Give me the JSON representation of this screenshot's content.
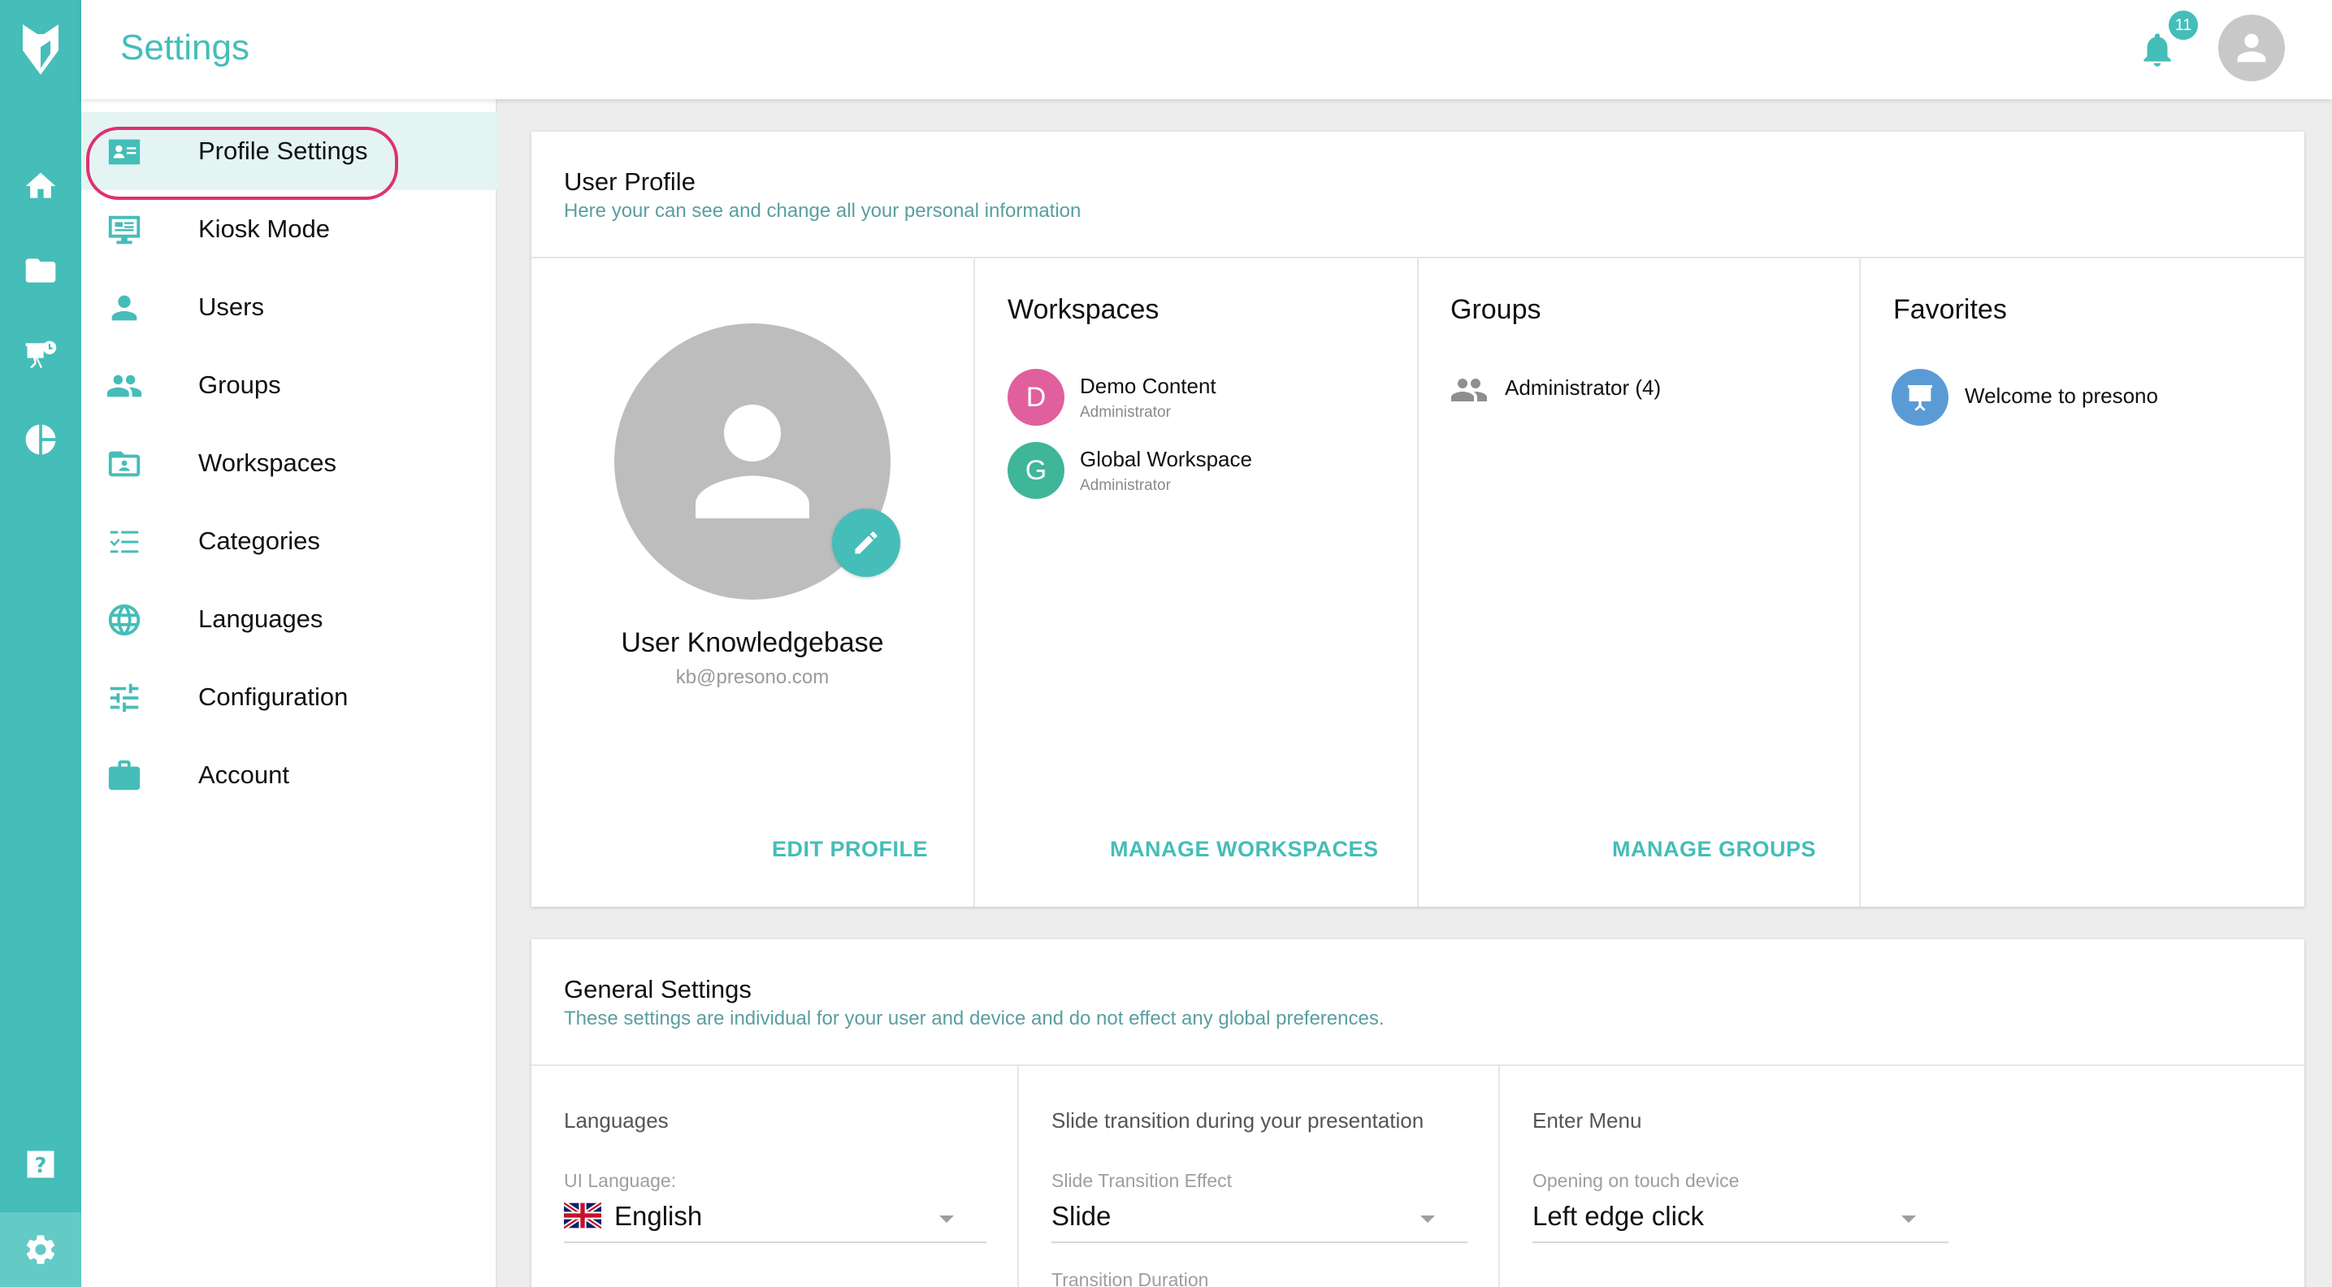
{
  "app": {
    "title": "Settings",
    "notifications_count": "11"
  },
  "rail": {
    "icons": [
      "logo-icon",
      "home-icon",
      "folder-icon",
      "presentation-icon",
      "pie-chart-icon",
      "help-icon",
      "settings-icon"
    ]
  },
  "menu": {
    "items": [
      {
        "label": "Profile Settings",
        "icon": "profile-card-icon"
      },
      {
        "label": "Kiosk Mode",
        "icon": "kiosk-icon"
      },
      {
        "label": "Users",
        "icon": "user-icon"
      },
      {
        "label": "Groups",
        "icon": "groups-icon"
      },
      {
        "label": "Workspaces",
        "icon": "workspace-icon"
      },
      {
        "label": "Categories",
        "icon": "categories-icon"
      },
      {
        "label": "Languages",
        "icon": "globe-icon"
      },
      {
        "label": "Configuration",
        "icon": "sliders-icon"
      },
      {
        "label": "Account",
        "icon": "briefcase-icon"
      }
    ]
  },
  "user_profile": {
    "title": "User Profile",
    "subtitle": "Here your can see and change all your personal information",
    "name": "User Knowledgebase",
    "email": "kb@presono.com",
    "edit_link": "EDIT PROFILE"
  },
  "workspaces": {
    "title": "Workspaces",
    "items": [
      {
        "initial": "D",
        "name": "Demo Content",
        "role": "Administrator",
        "color": "#e0609e"
      },
      {
        "initial": "G",
        "name": "Global Workspace",
        "role": "Administrator",
        "color": "#3fb59a"
      }
    ],
    "manage_link": "MANAGE WORKSPACES"
  },
  "groups": {
    "title": "Groups",
    "items": [
      {
        "name": "Administrator (4)"
      }
    ],
    "manage_link": "MANAGE GROUPS"
  },
  "favorites": {
    "title": "Favorites",
    "items": [
      {
        "name": "Welcome to presono"
      }
    ]
  },
  "general_settings": {
    "title": "General Settings",
    "subtitle": "These settings are individual for your user and device and do not effect any global preferences.",
    "languages": {
      "heading": "Languages",
      "field_label": "UI Language:",
      "value": "English"
    },
    "slide_transition": {
      "heading": "Slide transition during your presentation",
      "field_label": "Slide Transition Effect",
      "value": "Slide",
      "second_field_label": "Transition Duration"
    },
    "enter_menu": {
      "heading": "Enter Menu",
      "field_label": "Opening on touch device",
      "value": "Left edge click"
    }
  },
  "colors": {
    "accent": "#45bdb8",
    "highlight_ring": "#e0306f"
  }
}
